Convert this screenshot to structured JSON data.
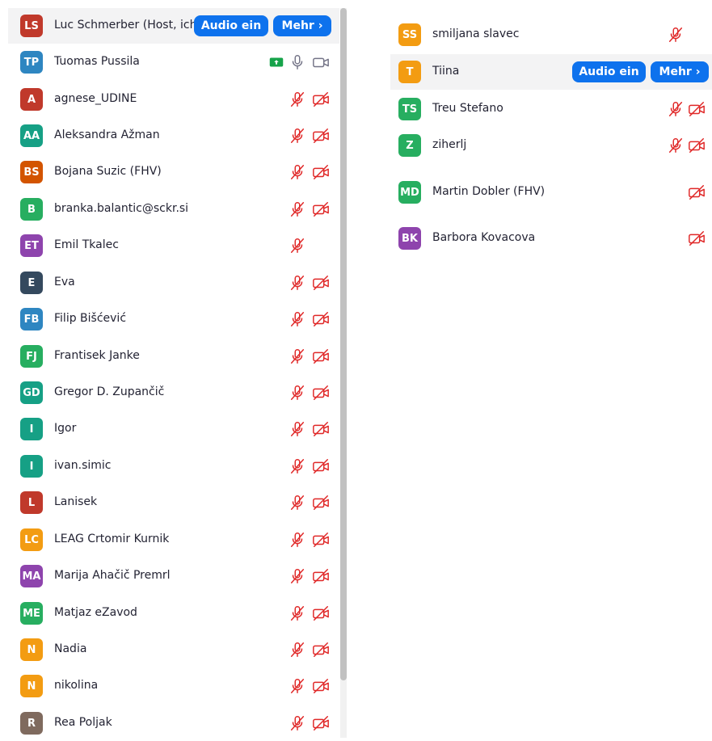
{
  "labels": {
    "audio_on": "Audio ein",
    "more": "Mehr ›"
  },
  "colors": {
    "accent": "#0e72ed",
    "muted_icon": "#e02828",
    "normal_icon": "#747487",
    "share_green": "#16a34a"
  },
  "left_participants": [
    {
      "initials": "LS",
      "name": "Luc Schmerber (Host, ich)",
      "color": "#c0392b",
      "highlight": true,
      "buttons": true,
      "mic": "none",
      "video": "none"
    },
    {
      "initials": "TP",
      "name": "Tuomas Pussila",
      "color": "#2e86c1",
      "highlight": false,
      "buttons": false,
      "share": true,
      "mic": "on",
      "video": "on"
    },
    {
      "initials": "A",
      "name": "agnese_UDINE",
      "color": "#c0392b",
      "mic": "muted",
      "video": "off"
    },
    {
      "initials": "AA",
      "name": "Aleksandra Ažman",
      "color": "#16a085",
      "mic": "muted",
      "video": "off"
    },
    {
      "initials": "BS",
      "name": "Bojana Suzic (FHV)",
      "color": "#d35400",
      "mic": "muted",
      "video": "off"
    },
    {
      "initials": "B",
      "name": "branka.balantic@sckr.si",
      "color": "#27ae60",
      "mic": "muted",
      "video": "off"
    },
    {
      "initials": "ET",
      "name": "Emil Tkalec",
      "color": "#8e44ad",
      "mic": "muted",
      "video": "none"
    },
    {
      "initials": "E",
      "name": "Eva",
      "color": "#34495e",
      "mic": "muted",
      "video": "off"
    },
    {
      "initials": "FB",
      "name": "Filip Bišćević",
      "color": "#2e86c1",
      "mic": "muted",
      "video": "off"
    },
    {
      "initials": "FJ",
      "name": "Frantisek Janke",
      "color": "#27ae60",
      "mic": "muted",
      "video": "off"
    },
    {
      "initials": "GD",
      "name": "Gregor D. Zupančič",
      "color": "#16a085",
      "mic": "muted",
      "video": "off"
    },
    {
      "initials": "I",
      "name": "Igor",
      "color": "#16a085",
      "mic": "muted",
      "video": "off"
    },
    {
      "initials": "I",
      "name": "ivan.simic",
      "color": "#16a085",
      "mic": "muted",
      "video": "off"
    },
    {
      "initials": "L",
      "name": "Lanisek",
      "color": "#c0392b",
      "mic": "muted",
      "video": "off"
    },
    {
      "initials": "LC",
      "name": "LEAG Crtomir Kurnik",
      "color": "#f39c12",
      "mic": "muted",
      "video": "off"
    },
    {
      "initials": "MA",
      "name": "Marija Ahačič Premrl",
      "color": "#8e44ad",
      "mic": "muted",
      "video": "off"
    },
    {
      "initials": "ME",
      "name": "Matjaz eZavod",
      "color": "#27ae60",
      "mic": "muted",
      "video": "off"
    },
    {
      "initials": "N",
      "name": "Nadia",
      "color": "#f39c12",
      "mic": "muted",
      "video": "off"
    },
    {
      "initials": "N",
      "name": "nikolina",
      "color": "#f39c12",
      "mic": "muted",
      "video": "off"
    },
    {
      "initials": "R",
      "name": "Rea Poljak",
      "color": "#7f6a5e",
      "mic": "muted",
      "video": "off"
    }
  ],
  "right_participants": [
    {
      "initials": "SS",
      "name": "smiljana slavec",
      "color": "#f39c12",
      "mic": "muted",
      "video": "none"
    },
    {
      "initials": "T",
      "name": "Tiina",
      "color": "#f39c12",
      "highlight": true,
      "buttons": true,
      "mic": "none",
      "video": "none"
    },
    {
      "initials": "TS",
      "name": "Treu Stefano",
      "color": "#27ae60",
      "mic": "muted",
      "video": "off"
    },
    {
      "initials": "Z",
      "name": "ziherlj",
      "color": "#27ae60",
      "mic": "muted",
      "video": "off"
    },
    {
      "initials": "MD",
      "name": "Martin Dobler (FHV)",
      "color": "#27ae60",
      "mic": "none",
      "video": "off"
    },
    {
      "initials": "BK",
      "name": "Barbora Kovacova",
      "color": "#8e44ad",
      "mic": "none",
      "video": "off"
    }
  ]
}
